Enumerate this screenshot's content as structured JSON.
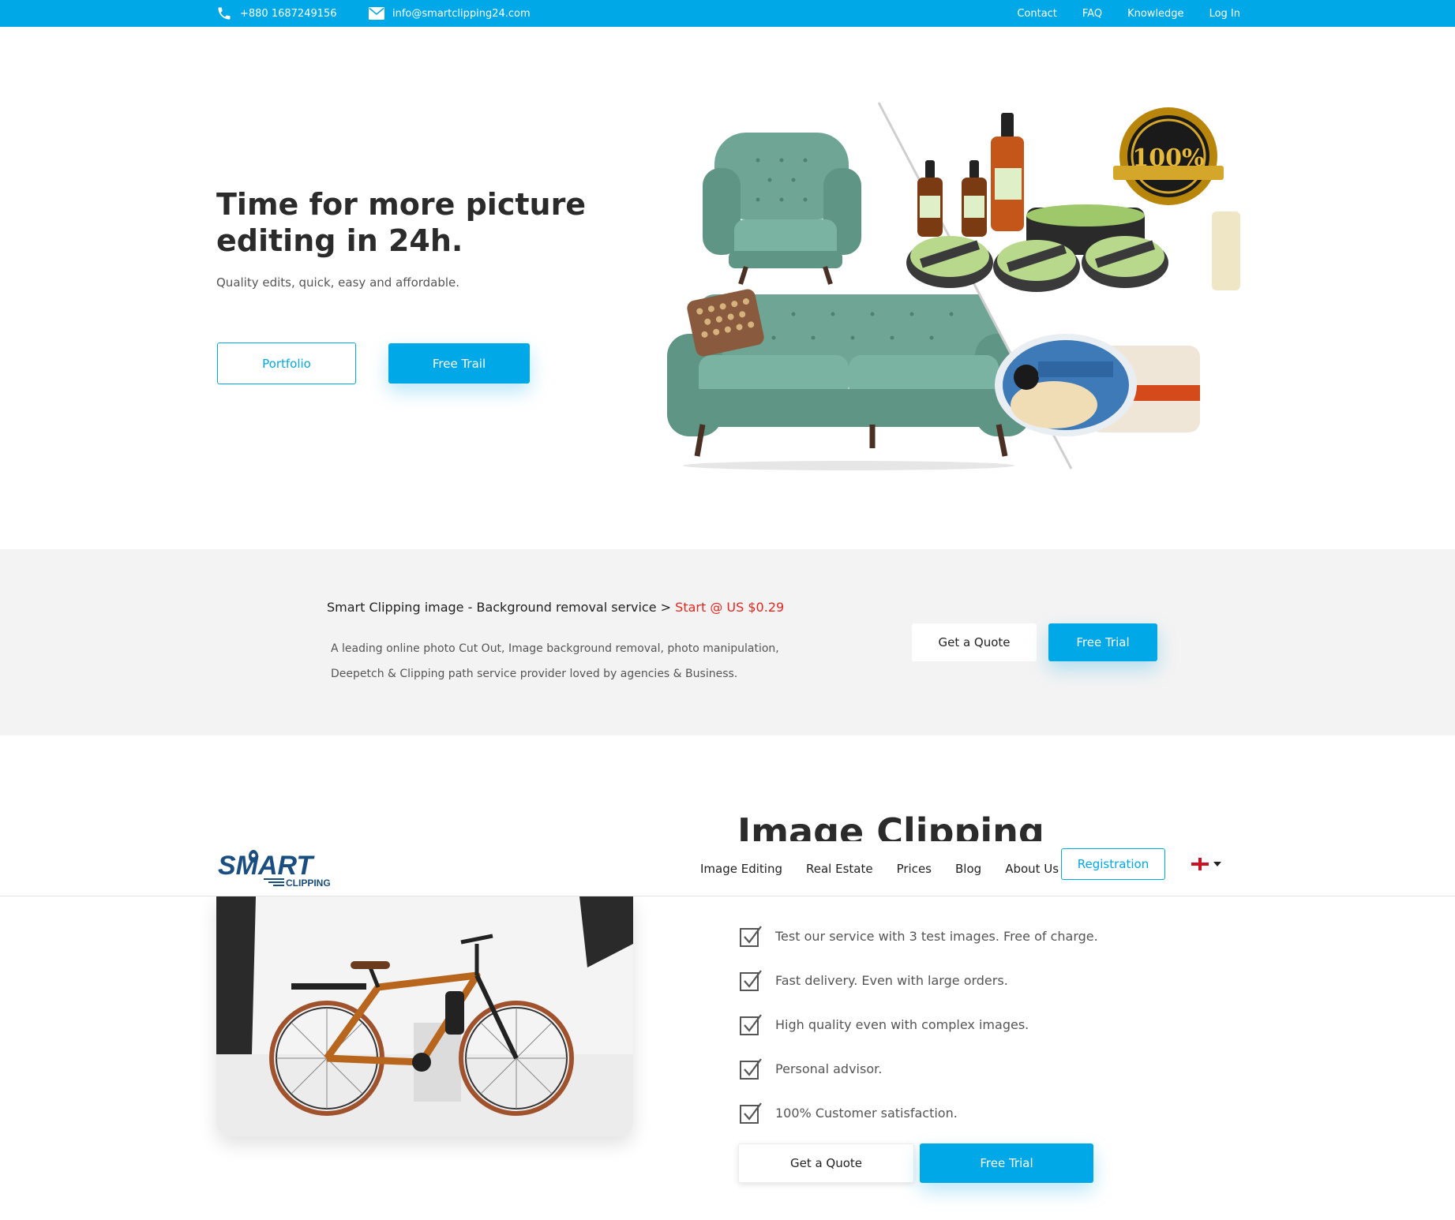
{
  "topbar": {
    "phone": "+880 1687249156",
    "email": "info@smartclipping24.com",
    "links": [
      "Contact",
      "FAQ",
      "Knowledge",
      "Log In"
    ]
  },
  "hero": {
    "title": "Time for more picture editing in 24h.",
    "subtitle": "Quality edits, quick, easy and affordable.",
    "portfolio_label": "Portfolio",
    "free_trail_label": "Free Trail",
    "badge_text": "100%"
  },
  "band": {
    "title": "Smart Clipping image - Background removal service >",
    "price": "Start @ US $0.29",
    "description": "A leading online photo Cut Out, Image background removal, photo manipulation, Deepetch & Clipping path service provider loved by agencies & Business.",
    "quote_label": "Get a Quote",
    "trial_label": "Free Trial"
  },
  "section": {
    "heading": "Image Clipping"
  },
  "navbar": {
    "logo_text": "SMART",
    "logo_sub": "CLIPPING",
    "items": [
      "Image Editing",
      "Real Estate",
      "Prices",
      "Blog",
      "About Us"
    ],
    "registration_label": "Registration"
  },
  "features": {
    "items": [
      "Test our service with 3 test images. Free of charge.",
      "Fast delivery. Even with large orders.",
      "High quality even with complex images.",
      "Personal advisor.",
      "100% Customer satisfaction."
    ],
    "quote_label": "Get a Quote",
    "trial_label": "Free Trial"
  },
  "colors": {
    "accent": "#00a8e8",
    "price": "#e8261e",
    "band_bg": "#f3f3f3",
    "sofa": "#6fa594"
  }
}
